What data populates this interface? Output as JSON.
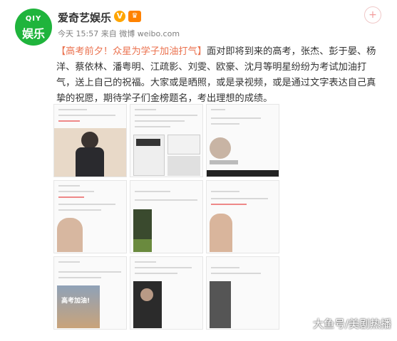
{
  "account": {
    "name": "爱奇艺娱乐",
    "logo_top": "QIY",
    "logo_bottom": "娱乐",
    "verified_mark": "V",
    "member_mark": "♛"
  },
  "meta": {
    "time": "今天 15:57",
    "source_prefix": "来自",
    "source": "微博 weibo.com"
  },
  "follow_icon": "+",
  "post": {
    "topic": "【高考前夕！众星为学子加油打气】",
    "body": "面对即将到来的高考，张杰、彭于晏、杨洋、蔡依林、潘粤明、江疏影、刘雯、欧豪、沈月等明星纷纷为考试加油打气，送上自己的祝福。大家或是晒照，或是录视频，或是通过文字表达自己真挚的祝愿，期待学子们金榜题名，考出理想的成绩。"
  },
  "photos": [
    {
      "name": "photo-1",
      "caption": "",
      "overlay": ""
    },
    {
      "name": "photo-2",
      "caption": "",
      "overlay": ""
    },
    {
      "name": "photo-3",
      "caption": "",
      "overlay": ""
    },
    {
      "name": "photo-4",
      "caption": "",
      "overlay": ""
    },
    {
      "name": "photo-5",
      "caption": "",
      "overlay": ""
    },
    {
      "name": "photo-6",
      "caption": "",
      "overlay": ""
    },
    {
      "name": "photo-7",
      "caption": "",
      "overlay": "高考加油!"
    },
    {
      "name": "photo-8",
      "caption": "",
      "overlay": ""
    },
    {
      "name": "photo-9",
      "caption": "",
      "overlay": ""
    }
  ],
  "watermark": "大鱼号/美剧热播"
}
